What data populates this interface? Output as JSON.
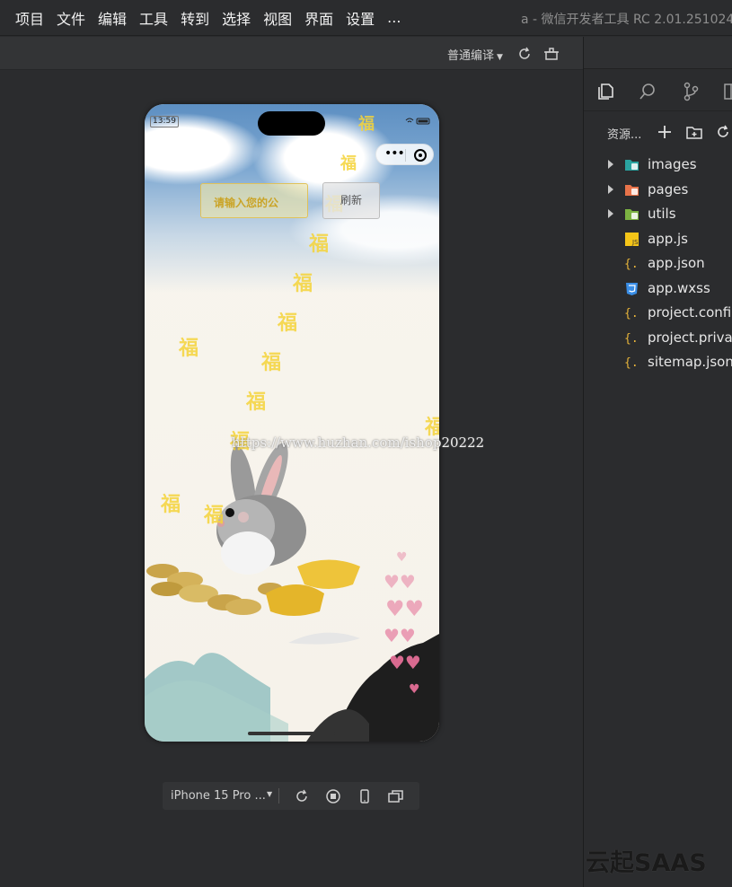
{
  "menu": {
    "items": [
      "项目",
      "文件",
      "编辑",
      "工具",
      "转到",
      "选择",
      "视图",
      "界面",
      "设置",
      "..."
    ],
    "window_title": "a - 微信开发者工具 RC 2.01.251024"
  },
  "toolbar": {
    "compile_mode": "普通编译",
    "icons": [
      "refresh-icon",
      "clear-cache-icon"
    ]
  },
  "phone": {
    "status_time": "13:59",
    "name_input_placeholder": "请输入您的公",
    "refresh_label": "刷新",
    "watermark": "https://www.huzhan.com/ishop20222",
    "fu_char": "福"
  },
  "device_bar": {
    "device_name": "iPhone 15 Pro ...",
    "icons": [
      "rotate-icon",
      "record-icon",
      "phone-icon",
      "multi-window-icon"
    ]
  },
  "explorer": {
    "title": "资源...",
    "tab_icons": [
      "files-icon",
      "search-icon",
      "source-control-icon",
      "extensions-icon"
    ],
    "header_icons": [
      "new-file-icon",
      "new-folder-icon",
      "refresh-explorer-icon"
    ],
    "files": [
      {
        "name": "images",
        "type": "folder",
        "color": "#2aa3a0"
      },
      {
        "name": "pages",
        "type": "folder",
        "color": "#e8734a"
      },
      {
        "name": "utils",
        "type": "folder",
        "color": "#7cb342"
      },
      {
        "name": "app.js",
        "type": "js",
        "color": "#f5c518"
      },
      {
        "name": "app.json",
        "type": "json",
        "color": "#e8b53a"
      },
      {
        "name": "app.wxss",
        "type": "css",
        "color": "#3a8ee6"
      },
      {
        "name": "project.config",
        "type": "json",
        "color": "#e8b53a"
      },
      {
        "name": "project.privat",
        "type": "json",
        "color": "#e8b53a"
      },
      {
        "name": "sitemap.json",
        "type": "json",
        "color": "#e8b53a"
      }
    ]
  },
  "brand": "云起SAAS"
}
